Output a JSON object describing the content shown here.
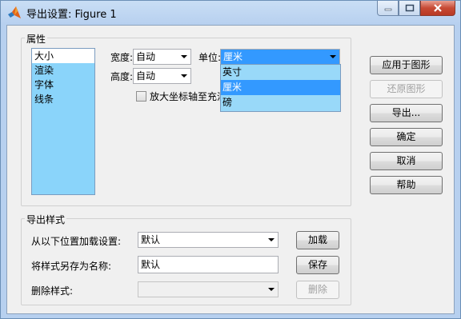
{
  "window": {
    "title": "导出设置: Figure 1",
    "controls": {
      "minimize": "minimize-icon",
      "maximize": "maximize-icon",
      "close": "close-icon"
    }
  },
  "properties": {
    "group_label": "属性",
    "categories": [
      "大小",
      "渲染",
      "字体",
      "线条"
    ],
    "selected_category": "大小",
    "width_label": "宽度:",
    "width_value": "自动",
    "height_label": "高度:",
    "height_value": "自动",
    "unit_label": "单位:",
    "unit_value": "厘米",
    "unit_options": [
      "英寸",
      "厘米",
      "磅"
    ],
    "unit_highlighted": "厘米",
    "expand_axes_label": "放大坐标轴至充满"
  },
  "side_buttons": {
    "apply": "应用于图形",
    "restore": "还原图形",
    "export": "导出...",
    "ok": "确定",
    "cancel": "取消",
    "help": "帮助"
  },
  "export_styles": {
    "group_label": "导出样式",
    "load_label": "从以下位置加载设置:",
    "load_value": "默认",
    "load_button": "加载",
    "save_label": "将样式另存为名称:",
    "save_value": "默认",
    "save_button": "保存",
    "delete_label": "删除样式:",
    "delete_value": "",
    "delete_button": "删除"
  },
  "colors": {
    "title_bar": "#b7d0ef",
    "list_background": "#8ad4fa",
    "highlight": "#3399ff",
    "close_button": "#c74a35"
  }
}
